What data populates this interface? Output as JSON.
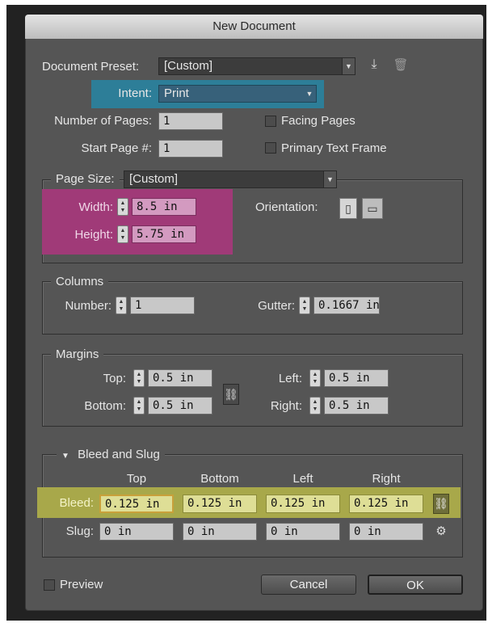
{
  "window": {
    "title": "New Document"
  },
  "preset": {
    "label": "Document Preset:",
    "value": "[Custom]"
  },
  "intent": {
    "label": "Intent:",
    "value": "Print"
  },
  "pages": {
    "number_label": "Number of Pages:",
    "number_value": "1",
    "start_label": "Start Page #:",
    "start_value": "1",
    "facing_label": "Facing Pages",
    "primary_label": "Primary Text Frame"
  },
  "page_size": {
    "label": "Page Size:",
    "value": "[Custom]",
    "width_label": "Width:",
    "width_value": "8.5 in",
    "height_label": "Height:",
    "height_value": "5.75 in",
    "orientation_label": "Orientation:"
  },
  "columns": {
    "title": "Columns",
    "number_label": "Number:",
    "number_value": "1",
    "gutter_label": "Gutter:",
    "gutter_value": "0.1667 in"
  },
  "margins": {
    "title": "Margins",
    "top_label": "Top:",
    "top_value": "0.5 in",
    "bottom_label": "Bottom:",
    "bottom_value": "0.5 in",
    "left_label": "Left:",
    "left_value": "0.5 in",
    "right_label": "Right:",
    "right_value": "0.5 in"
  },
  "bleed_slug": {
    "title": "Bleed and Slug",
    "headers": [
      "Top",
      "Bottom",
      "Left",
      "Right"
    ],
    "bleed_label": "Bleed:",
    "bleed_values": [
      "0.125 in",
      "0.125 in",
      "0.125 in",
      "0.125 in"
    ],
    "slug_label": "Slug:",
    "slug_values": [
      "0 in",
      "0 in",
      "0 in",
      "0 in"
    ]
  },
  "footer": {
    "preview_label": "Preview",
    "cancel_label": "Cancel",
    "ok_label": "OK"
  },
  "colors": {
    "intent_highlight": "#2d7e98",
    "size_highlight": "#a03a78",
    "bleed_highlight": "#a8a84a"
  }
}
